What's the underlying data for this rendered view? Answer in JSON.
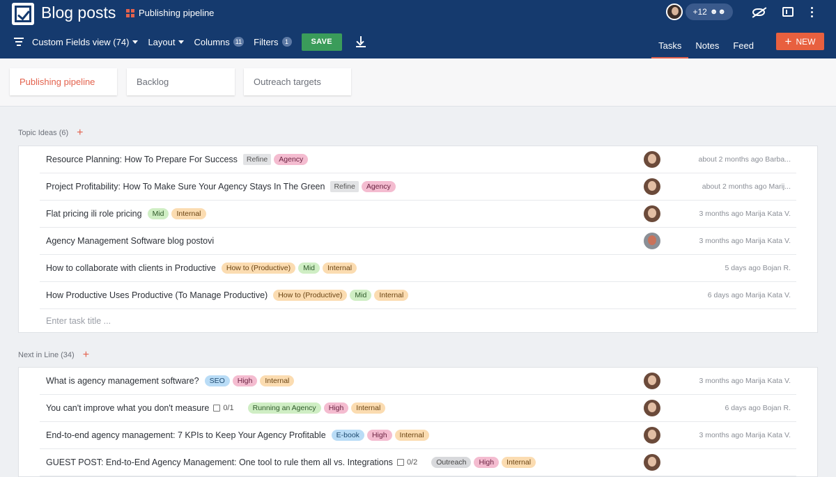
{
  "header": {
    "title": "Blog posts",
    "breadcrumb": "Publishing pipeline",
    "members_more": "+12",
    "toolbar": {
      "view_label": "Custom Fields view (74)",
      "layout_label": "Layout",
      "columns_label": "Columns",
      "columns_count": "11",
      "filters_label": "Filters",
      "filters_count": "1",
      "save_label": "SAVE"
    },
    "tabs": [
      {
        "label": "Tasks",
        "active": true
      },
      {
        "label": "Notes",
        "active": false
      },
      {
        "label": "Feed",
        "active": false
      }
    ],
    "new_label": "NEW"
  },
  "section_tabs": [
    {
      "label": "Publishing pipeline",
      "active": true
    },
    {
      "label": "Backlog",
      "active": false
    },
    {
      "label": "Outreach targets",
      "active": false
    }
  ],
  "groups": [
    {
      "title": "Topic Ideas (6)",
      "rows": [
        {
          "title": "Resource Planning: How To Prepare For Success",
          "tags": [
            {
              "t": "Refine",
              "c": "refine"
            },
            {
              "t": "Agency",
              "c": "agency"
            }
          ],
          "avatar": "photo",
          "meta": "about 2 months ago Barba..."
        },
        {
          "title": "Project Profitability: How To Make Sure Your Agency Stays In The Green",
          "tags": [
            {
              "t": "Refine",
              "c": "refine"
            },
            {
              "t": "Agency",
              "c": "agency"
            }
          ],
          "avatar": "photo",
          "meta": "about 2 months ago Marij..."
        },
        {
          "title": "Flat pricing ili role pricing",
          "tags": [
            {
              "t": "Mid",
              "c": "mid"
            },
            {
              "t": "Internal",
              "c": "internal"
            }
          ],
          "avatar": "photo",
          "meta": "3 months ago Marija Kata V."
        },
        {
          "title": "Agency Management Software blog postovi",
          "tags": [],
          "avatar": "alt",
          "meta": "3 months ago Marija Kata V."
        },
        {
          "title": "How to collaborate with clients in Productive",
          "tags": [
            {
              "t": "How to (Productive)",
              "c": "howto"
            },
            {
              "t": "Mid",
              "c": "mid"
            },
            {
              "t": "Internal",
              "c": "internal"
            }
          ],
          "avatar": "",
          "meta": "5 days ago Bojan R."
        },
        {
          "title": "How Productive Uses Productive (To Manage Productive)",
          "tags": [
            {
              "t": "How to (Productive)",
              "c": "howto"
            },
            {
              "t": "Mid",
              "c": "mid"
            },
            {
              "t": "Internal",
              "c": "internal"
            }
          ],
          "avatar": "",
          "meta": "6 days ago Marija Kata V."
        }
      ],
      "input_placeholder": "Enter task title ..."
    },
    {
      "title": "Next in Line (34)",
      "rows": [
        {
          "title": "What is agency management software?",
          "tags": [
            {
              "t": "SEO",
              "c": "seo"
            },
            {
              "t": "High",
              "c": "high"
            },
            {
              "t": "Internal",
              "c": "internal"
            }
          ],
          "avatar": "photo",
          "meta": "3 months ago Marija Kata V."
        },
        {
          "title": "You can't improve what you don't measure",
          "checklist": "0/1",
          "tags": [
            {
              "t": "Running an Agency",
              "c": "running"
            },
            {
              "t": "High",
              "c": "high"
            },
            {
              "t": "Internal",
              "c": "internal"
            }
          ],
          "avatar": "photo",
          "meta": "6 days ago Bojan R."
        },
        {
          "title": "End-to-end agency management: 7 KPIs to Keep Your Agency Profitable",
          "tags": [
            {
              "t": "E-book",
              "c": "ebook"
            },
            {
              "t": "High",
              "c": "high"
            },
            {
              "t": "Internal",
              "c": "internal"
            }
          ],
          "avatar": "photo",
          "meta": "3 months ago Marija Kata V."
        },
        {
          "title": "GUEST POST: End-to-End Agency Management: One tool to rule them all vs. Integrations",
          "checklist": "0/2",
          "tags": [
            {
              "t": "Outreach",
              "c": "outreach"
            },
            {
              "t": "High",
              "c": "high"
            },
            {
              "t": "Internal",
              "c": "internal"
            }
          ],
          "avatar": "photo",
          "meta": ""
        }
      ]
    }
  ],
  "colors": {
    "header_bg": "#153a6e",
    "accent": "#e3624d",
    "save_green": "#3a9c5a"
  }
}
